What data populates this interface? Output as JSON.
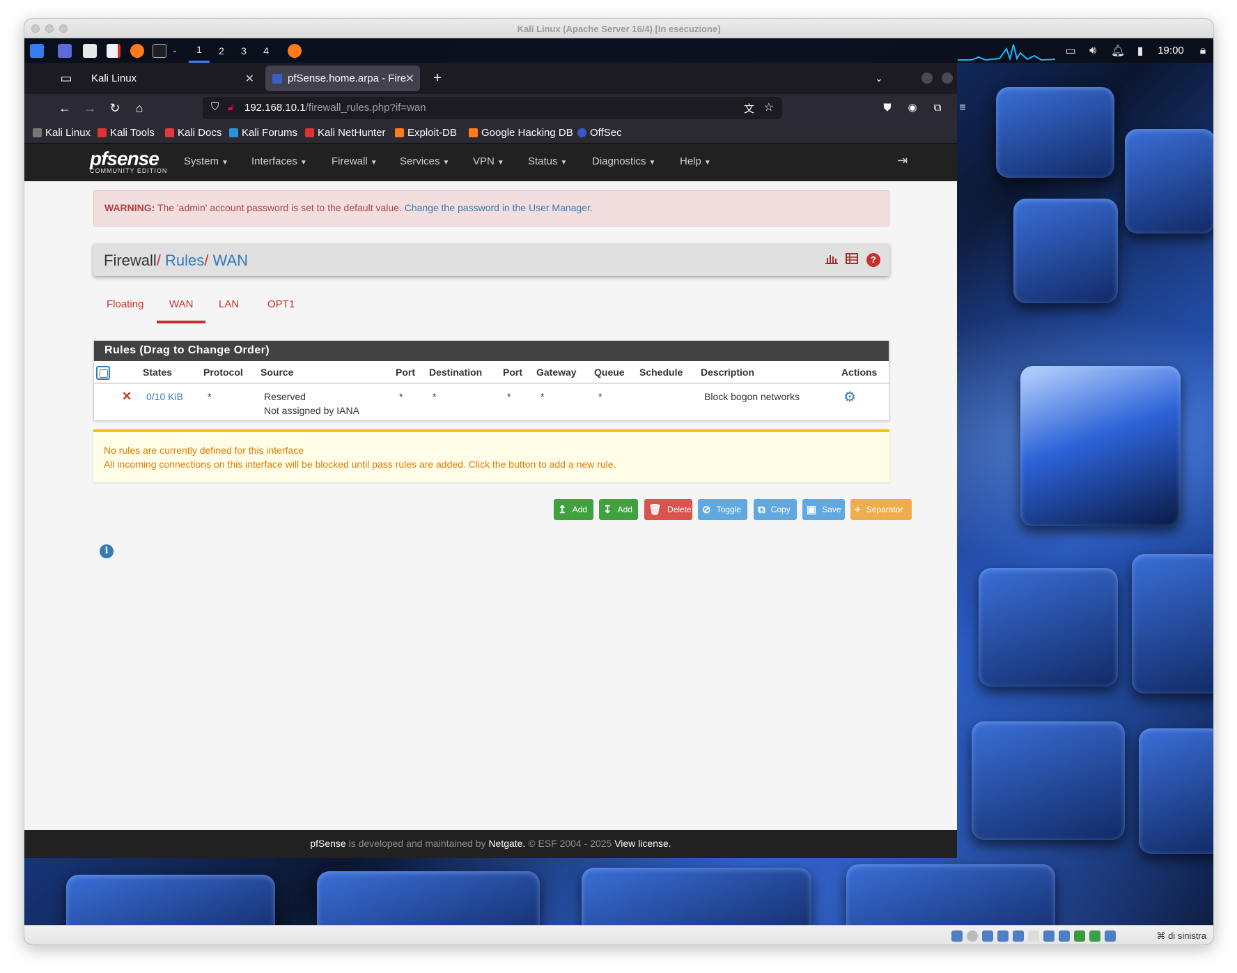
{
  "vm_window": {
    "title": "Kali Linux (Apache Server 16/4) [In esecuzione]",
    "host_key_label": "⌘ di sinistra"
  },
  "kali_panel": {
    "workspaces": [
      "1",
      "2",
      "3",
      "4"
    ],
    "clock": "19:00"
  },
  "browser": {
    "tabs": [
      {
        "label": "Kali Linux"
      },
      {
        "label": "pfSense.home.arpa - Fire"
      }
    ],
    "new_tab": "+",
    "url_host": "192.168.10.1",
    "url_path": "/firewall_rules.php?if=wan",
    "bookmarks": [
      "Kali Linux",
      "Kali Tools",
      "Kali Docs",
      "Kali Forums",
      "Kali NetHunter",
      "Exploit-DB",
      "Google Hacking DB",
      "OffSec"
    ]
  },
  "pfsense": {
    "logo_main": "pfsense",
    "logo_sub": "COMMUNITY EDITION",
    "menu": [
      "System",
      "Interfaces",
      "Firewall",
      "Services",
      "VPN",
      "Status",
      "Diagnostics",
      "Help"
    ],
    "warning": {
      "label": "WARNING:",
      "text": " The 'admin' account password is set to the default value. ",
      "link": "Change the password in the User Manager."
    },
    "breadcrumb": {
      "root": "Firewall",
      "sep1": "/ ",
      "level2": "Rules",
      "sep2": "/ ",
      "level3": "WAN"
    },
    "interface_tabs": [
      "Floating",
      "WAN",
      "LAN",
      "OPT1"
    ],
    "active_tab": "WAN",
    "rules_heading": "Rules (Drag to Change Order)",
    "columns": [
      "States",
      "Protocol",
      "Source",
      "Port",
      "Destination",
      "Port",
      "Gateway",
      "Queue",
      "Schedule",
      "Description",
      "Actions"
    ],
    "rule": {
      "states": "0/10 KiB",
      "protocol": "*",
      "source_line1": "Reserved",
      "source_line2": "Not assigned by IANA",
      "source_port": "*",
      "destination": "*",
      "dest_port": "*",
      "gateway": "*",
      "queue": "*",
      "schedule": "",
      "description": "Block bogon networks"
    },
    "notice_line1": "No rules are currently defined for this interface",
    "notice_line2": "All incoming connections on this interface will be blocked until pass rules are added. Click the button to add a new rule.",
    "buttons": {
      "add_top": "Add",
      "add_bottom": "Add",
      "delete": "Delete",
      "toggle": "Toggle",
      "copy": "Copy",
      "save": "Save",
      "separator": "Separator"
    },
    "footer": {
      "brand": "pfSense",
      "text1": " is developed and maintained by ",
      "company": "Netgate.",
      "text2": " © ESF 2004 - 2025 ",
      "license": "View license."
    }
  },
  "colors": {
    "pf_red": "#c9302c",
    "pf_link": "#337ab7",
    "pf_navbar": "#212121",
    "warning_bg": "#f2dede",
    "notice_bg": "#fffce8"
  }
}
